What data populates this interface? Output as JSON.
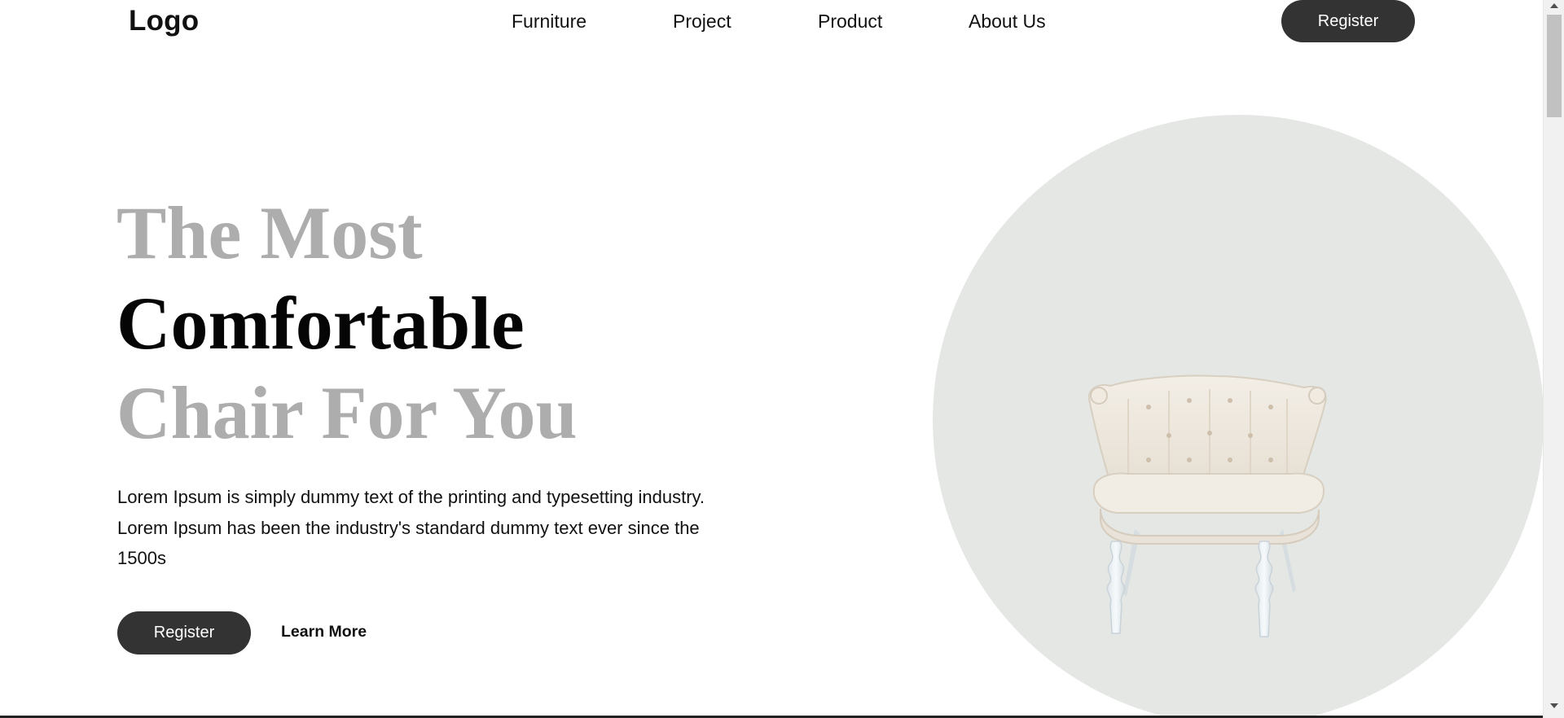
{
  "header": {
    "logo": "Logo",
    "nav": [
      {
        "label": "Furniture"
      },
      {
        "label": "Project"
      },
      {
        "label": "Product"
      },
      {
        "label": "About Us"
      }
    ],
    "register_label": "Register"
  },
  "hero": {
    "headline": {
      "line1": "The Most",
      "line2": "Comfortable",
      "line3": "Chair For You"
    },
    "description": "Lorem Ipsum is simply dummy text of the printing and typesetting industry. Lorem Ipsum has been the industry's standard dummy text ever since the 1500s",
    "register_label": "Register",
    "learn_more_label": "Learn More"
  },
  "colors": {
    "button_dark": "#333333",
    "headline_light": "#adadad",
    "headline_dark": "#050505",
    "circle_bg": "#e4e7e4",
    "chair_fabric": "#efe9df"
  },
  "icons": {
    "chair_image": "armchair-illustration"
  }
}
